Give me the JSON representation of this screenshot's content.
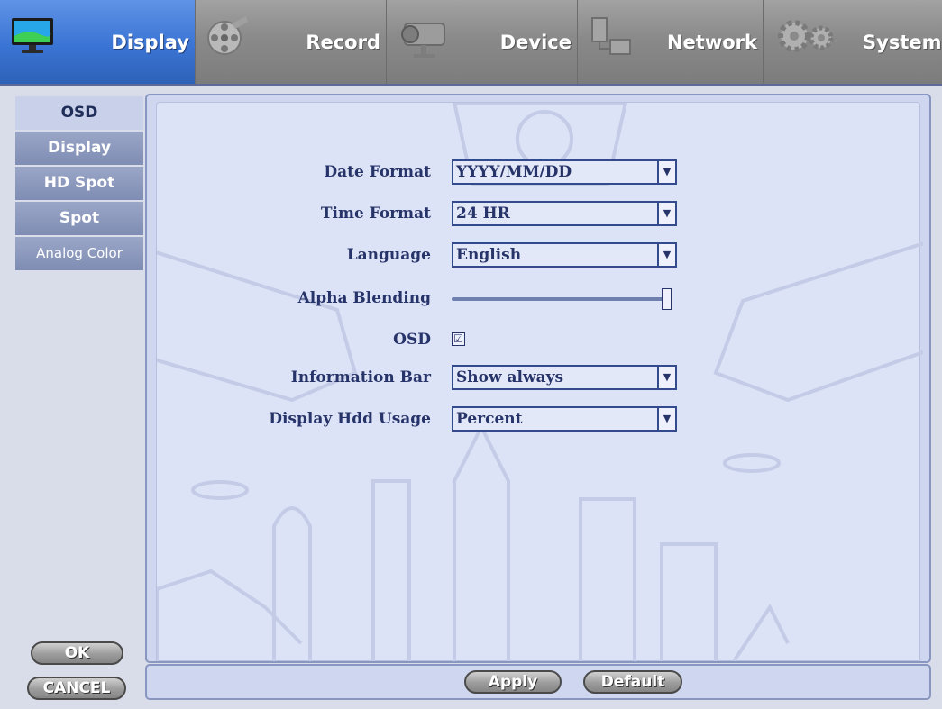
{
  "tabs": [
    {
      "label": "Display",
      "icon": "monitor-icon",
      "active": true
    },
    {
      "label": "Record",
      "icon": "film-reel-icon",
      "active": false
    },
    {
      "label": "Device",
      "icon": "camera-icon",
      "active": false
    },
    {
      "label": "Network",
      "icon": "network-monitor-icon",
      "active": false
    },
    {
      "label": "System",
      "icon": "gears-icon",
      "active": false
    }
  ],
  "sidebar": {
    "items": [
      {
        "label": "OSD",
        "active": true
      },
      {
        "label": "Display",
        "active": false
      },
      {
        "label": "HD Spot",
        "active": false
      },
      {
        "label": "Spot",
        "active": false
      },
      {
        "label": "Analog Color",
        "active": false
      }
    ]
  },
  "form": {
    "date_format": {
      "label": "Date Format",
      "value": "YYYY/MM/DD"
    },
    "time_format": {
      "label": "Time Format",
      "value": "24 HR"
    },
    "language": {
      "label": "Language",
      "value": "English"
    },
    "alpha_blending": {
      "label": "Alpha Blending",
      "level": 1.0
    },
    "osd": {
      "label": "OSD",
      "checked": true,
      "mark": "☑"
    },
    "information_bar": {
      "label": "Information Bar",
      "value": "Show always"
    },
    "display_hdd_usage": {
      "label": "Display Hdd Usage",
      "value": "Percent"
    }
  },
  "buttons": {
    "ok": "OK",
    "cancel": "CANCEL",
    "apply": "Apply",
    "default": "Default"
  },
  "colors": {
    "active_tab": "#3a74d4",
    "label_text": "#27346a",
    "panel_bg": "#dde3f6"
  }
}
